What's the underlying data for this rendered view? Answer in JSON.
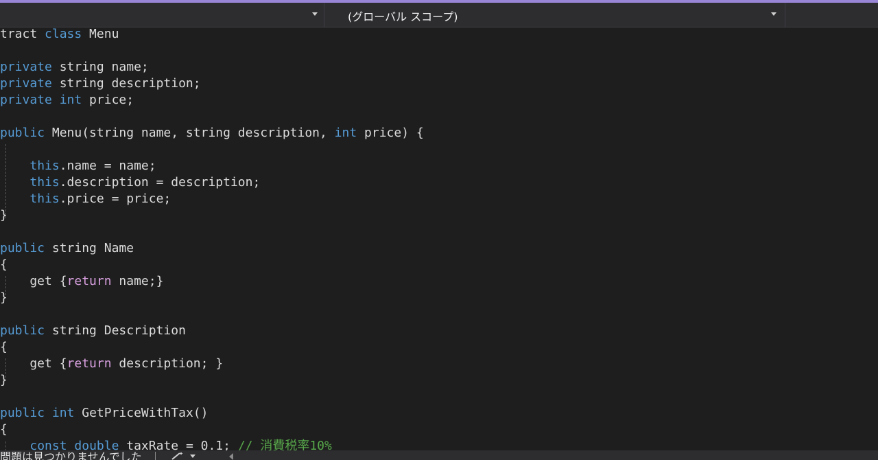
{
  "navbar": {
    "member_dropdown": {
      "value": ""
    },
    "scope_dropdown": {
      "value": "(グローバル スコープ)"
    }
  },
  "editor": {
    "lines": [
      {
        "tokens": [
          {
            "t": "tract ",
            "c": "txt"
          },
          {
            "t": "class",
            "c": "kw"
          },
          {
            "t": " Menu",
            "c": "txt"
          }
        ]
      },
      {
        "tokens": []
      },
      {
        "tokens": [
          {
            "t": "private",
            "c": "kw"
          },
          {
            "t": " string name;",
            "c": "txt"
          }
        ]
      },
      {
        "tokens": [
          {
            "t": "private",
            "c": "kw"
          },
          {
            "t": " string description;",
            "c": "txt"
          }
        ]
      },
      {
        "tokens": [
          {
            "t": "private",
            "c": "kw"
          },
          {
            "t": " ",
            "c": "txt"
          },
          {
            "t": "int",
            "c": "kw"
          },
          {
            "t": " price;",
            "c": "txt"
          }
        ]
      },
      {
        "tokens": []
      },
      {
        "tokens": [
          {
            "t": "public",
            "c": "kw"
          },
          {
            "t": " Menu(string name, string description, ",
            "c": "txt"
          },
          {
            "t": "int",
            "c": "kw"
          },
          {
            "t": " price) {",
            "c": "txt"
          }
        ]
      },
      {
        "tokens": []
      },
      {
        "tokens": [
          {
            "t": "    ",
            "c": "txt"
          },
          {
            "t": "this",
            "c": "kw"
          },
          {
            "t": ".name = name;",
            "c": "txt"
          }
        ]
      },
      {
        "tokens": [
          {
            "t": "    ",
            "c": "txt"
          },
          {
            "t": "this",
            "c": "kw"
          },
          {
            "t": ".description = description;",
            "c": "txt"
          }
        ]
      },
      {
        "tokens": [
          {
            "t": "    ",
            "c": "txt"
          },
          {
            "t": "this",
            "c": "kw"
          },
          {
            "t": ".price = price;",
            "c": "txt"
          }
        ]
      },
      {
        "tokens": [
          {
            "t": "}",
            "c": "brace"
          }
        ]
      },
      {
        "tokens": []
      },
      {
        "tokens": [
          {
            "t": "public",
            "c": "kw"
          },
          {
            "t": " string Name",
            "c": "txt"
          }
        ]
      },
      {
        "tokens": [
          {
            "t": "{",
            "c": "brace"
          }
        ]
      },
      {
        "tokens": [
          {
            "t": "    get {",
            "c": "txt"
          },
          {
            "t": "return",
            "c": "ctrl"
          },
          {
            "t": " name;}",
            "c": "txt"
          }
        ]
      },
      {
        "tokens": [
          {
            "t": "}",
            "c": "brace"
          }
        ]
      },
      {
        "tokens": []
      },
      {
        "tokens": [
          {
            "t": "public",
            "c": "kw"
          },
          {
            "t": " string Description",
            "c": "txt"
          }
        ]
      },
      {
        "tokens": [
          {
            "t": "{",
            "c": "brace"
          }
        ]
      },
      {
        "tokens": [
          {
            "t": "    get {",
            "c": "txt"
          },
          {
            "t": "return",
            "c": "ctrl"
          },
          {
            "t": " description; }",
            "c": "txt"
          }
        ]
      },
      {
        "tokens": [
          {
            "t": "}",
            "c": "brace"
          }
        ]
      },
      {
        "tokens": []
      },
      {
        "tokens": [
          {
            "t": "public",
            "c": "kw"
          },
          {
            "t": " ",
            "c": "txt"
          },
          {
            "t": "int",
            "c": "kw"
          },
          {
            "t": " GetPriceWithTax()",
            "c": "txt"
          }
        ]
      },
      {
        "tokens": [
          {
            "t": "{",
            "c": "brace"
          }
        ]
      },
      {
        "tokens": [
          {
            "t": "    ",
            "c": "txt"
          },
          {
            "t": "const",
            "c": "kw"
          },
          {
            "t": " ",
            "c": "txt"
          },
          {
            "t": "double",
            "c": "kw"
          },
          {
            "t": " taxRate = 0.1; ",
            "c": "txt"
          },
          {
            "t": "// 消費税率10%",
            "c": "com"
          }
        ]
      }
    ]
  },
  "statusbar": {
    "message": "問題は見つかりませんでした"
  },
  "icons": {
    "dropdown": "chevron-down-icon",
    "wand": "wand-icon",
    "scroll_left": "scroll-left-icon"
  },
  "colors": {
    "accent": "#9a86d6",
    "keyword": "#569cd6",
    "control": "#d8a0df",
    "text": "#dcdcdc",
    "comment": "#57a64a",
    "background": "#1e1e1e"
  }
}
